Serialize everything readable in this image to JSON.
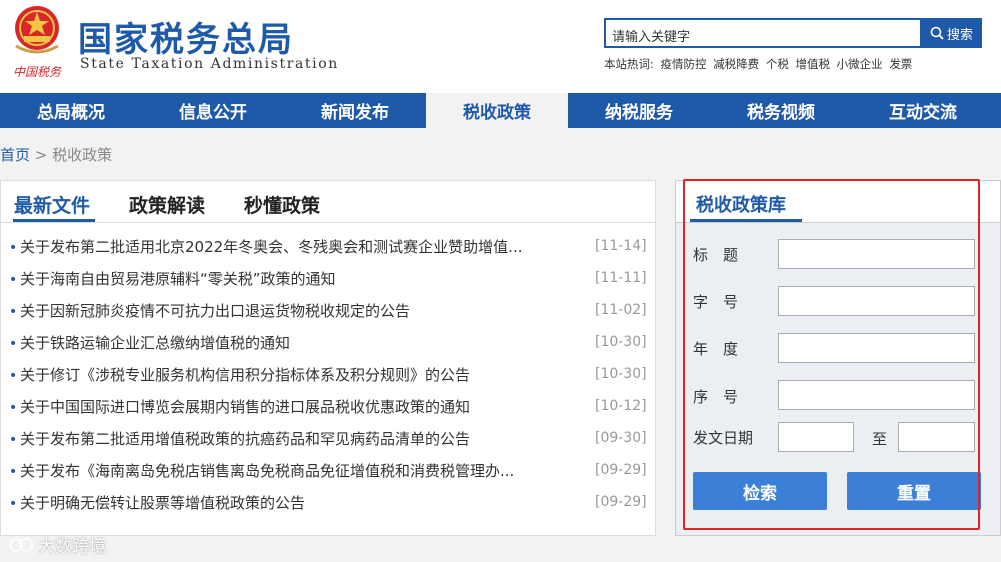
{
  "header": {
    "title_cn": "国家税务总局",
    "title_en": "State Taxation Administration",
    "logo_text": "中国税务"
  },
  "search": {
    "value": "请输入关键字",
    "button_label": "搜索",
    "hot_label": "本站热词:",
    "hot_words": [
      "疫情防控",
      "减税降费",
      "个税",
      "增值税",
      "小微企业",
      "发票"
    ]
  },
  "nav": {
    "items": [
      "总局概况",
      "信息公开",
      "新闻发布",
      "税收政策",
      "纳税服务",
      "税务视频",
      "互动交流"
    ],
    "active_index": 3
  },
  "breadcrumb": {
    "home": "首页",
    "sep": ">",
    "current": "税收政策"
  },
  "left": {
    "tabs": [
      "最新文件",
      "政策解读",
      "秒懂政策"
    ],
    "news": [
      {
        "title": "关于发布第二批适用北京2022年冬奥会、冬残奥会和测试赛企业赞助增值...",
        "date": "[11-14]"
      },
      {
        "title": "关于海南自由贸易港原辅料“零关税”政策的通知",
        "date": "[11-11]"
      },
      {
        "title": "关于因新冠肺炎疫情不可抗力出口退运货物税收规定的公告",
        "date": "[11-02]"
      },
      {
        "title": "关于铁路运输企业汇总缴纳增值税的通知",
        "date": "[10-30]"
      },
      {
        "title": "关于修订《涉税专业服务机构信用积分指标体系及积分规则》的公告",
        "date": "[10-30]"
      },
      {
        "title": "关于中国国际进口博览会展期内销售的进口展品税收优惠政策的通知",
        "date": "[10-12]"
      },
      {
        "title": "关于发布第二批适用增值税政策的抗癌药品和罕见病药品清单的公告",
        "date": "[09-30]"
      },
      {
        "title": "关于发布《海南离岛免税店销售离岛免税商品免征增值税和消费税管理办...",
        "date": "[09-29]"
      },
      {
        "title": "关于明确无偿转让股票等增值税政策的公告",
        "date": "[09-29]"
      }
    ]
  },
  "policy_db": {
    "title": "税收政策库",
    "labels": {
      "title": "标　题",
      "number": "字　号",
      "year": "年　度",
      "seq": "序　号",
      "date": "发文日期",
      "to": "至"
    },
    "search_button": "检索",
    "reset_button": "重置"
  },
  "watermark": "大数跨境",
  "colors": {
    "brand_blue": "#1f5aa8",
    "button_blue": "#3b7fd6",
    "highlight_red": "#e52222"
  }
}
